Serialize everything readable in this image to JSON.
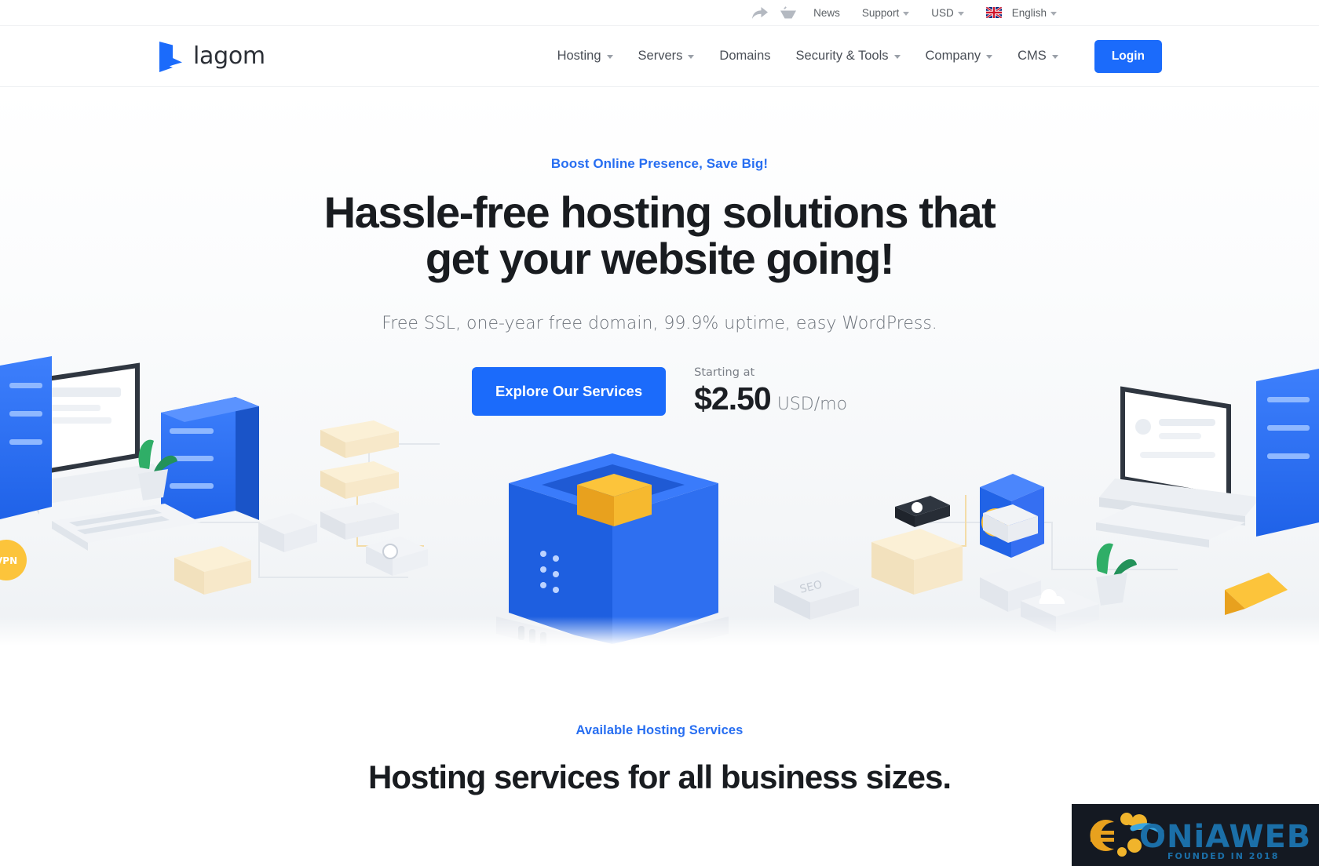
{
  "topbar": {
    "icons": [
      {
        "name": "share-icon"
      },
      {
        "name": "shopping-basket-icon"
      }
    ],
    "news_label": "News",
    "support_label": "Support",
    "currency_label": "USD",
    "language_label": "English",
    "flag": "uk-flag-icon"
  },
  "header": {
    "logo_text": "lagom",
    "nav": [
      {
        "label": "Hosting",
        "has_caret": true
      },
      {
        "label": "Servers",
        "has_caret": true
      },
      {
        "label": "Domains",
        "has_caret": false
      },
      {
        "label": "Security & Tools",
        "has_caret": true
      },
      {
        "label": "Company",
        "has_caret": true
      },
      {
        "label": "CMS",
        "has_caret": true
      }
    ],
    "login_label": "Login"
  },
  "hero": {
    "eyebrow": "Boost Online Presence, Save Big!",
    "title_line1": "Hassle-free hosting solutions that",
    "title_line2": "get your website going!",
    "subtitle": "Free SSL, one-year free domain, 99.9% uptime, easy WordPress.",
    "cta_label": "Explore Our Services",
    "price_label": "Starting at",
    "price_amount": "$2.50",
    "price_unit": "USD/mo"
  },
  "services": {
    "eyebrow": "Available Hosting Services",
    "title": "Hosting services for all business sizes."
  },
  "watermark": {
    "brand": "SONiAWEB",
    "tagline": "FOUNDED IN 2018"
  },
  "colors": {
    "accent_blue": "#1b6bfb",
    "link_blue": "#276ef1",
    "heading": "#191c20",
    "muted": "#6c727a"
  }
}
